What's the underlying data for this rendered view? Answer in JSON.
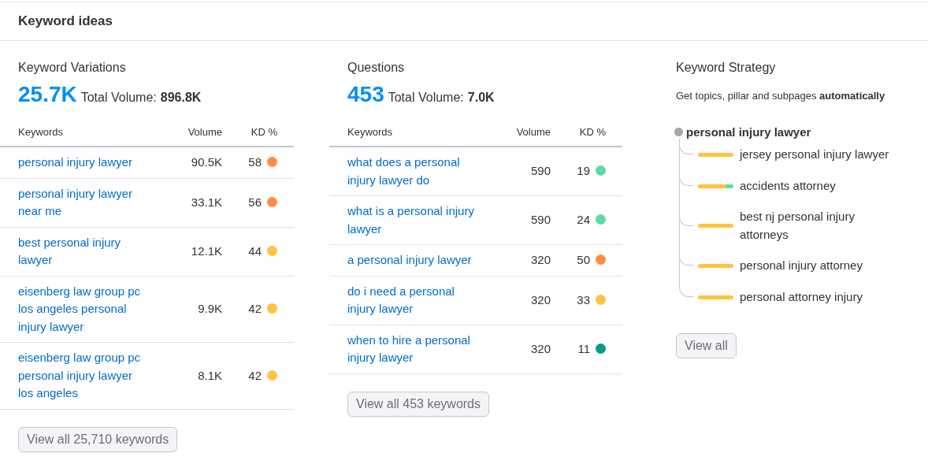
{
  "header": {
    "title": "Keyword ideas"
  },
  "variations": {
    "title": "Keyword Variations",
    "count": "25.7K",
    "total_label": "Total Volume:",
    "total_value": "896.8K",
    "columns": [
      "Keywords",
      "Volume",
      "KD %"
    ],
    "rows": [
      {
        "keyword": "personal injury lawyer",
        "volume": "90.5K",
        "kd": "58",
        "color": "#ff8c43"
      },
      {
        "keyword": "personal injury lawyer near me",
        "volume": "33.1K",
        "kd": "56",
        "color": "#ff8c43"
      },
      {
        "keyword": "best personal injury lawyer",
        "volume": "12.1K",
        "kd": "44",
        "color": "#ffc43d"
      },
      {
        "keyword": "eisenberg law group pc los angeles personal injury lawyer",
        "volume": "9.9K",
        "kd": "42",
        "color": "#ffc43d"
      },
      {
        "keyword": "eisenberg law group pc personal injury lawyer los angeles",
        "volume": "8.1K",
        "kd": "42",
        "color": "#ffc43d"
      }
    ],
    "button": "View all 25,710 keywords"
  },
  "questions": {
    "title": "Questions",
    "count": "453",
    "total_label": "Total Volume:",
    "total_value": "7.0K",
    "columns": [
      "Keywords",
      "Volume",
      "KD %"
    ],
    "rows": [
      {
        "keyword": "what does a personal injury lawyer do",
        "volume": "590",
        "kd": "19",
        "color": "#59dda5"
      },
      {
        "keyword": "what is a personal injury lawyer",
        "volume": "590",
        "kd": "24",
        "color": "#59dda5"
      },
      {
        "keyword": "a personal injury lawyer",
        "volume": "320",
        "kd": "50",
        "color": "#ff8c43"
      },
      {
        "keyword": "do i need a personal injury lawyer",
        "volume": "320",
        "kd": "33",
        "color": "#ffc43d"
      },
      {
        "keyword": "when to hire a personal injury lawyer",
        "volume": "320",
        "kd": "11",
        "color": "#009f81"
      }
    ],
    "button": "View all 453 keywords"
  },
  "strategy": {
    "title": "Keyword Strategy",
    "subtitle": "Get topics, pillar and subpages **automatically**",
    "root": {
      "label": "personal injury lawyer",
      "children": [
        {
          "label": "jersey personal injury lawyer",
          "segments": [
            {
              "color": "#ffc43d"
            }
          ]
        },
        {
          "label": "accidents attorney",
          "segments": [
            {
              "color": "#ffc43d"
            },
            {
              "color": "#59dda5"
            }
          ]
        },
        {
          "label": "best nj personal injury attorneys",
          "segments": [
            {
              "color": "#ffc43d"
            }
          ]
        },
        {
          "label": "personal injury attorney",
          "segments": [
            {
              "color": "#ffc43d"
            }
          ]
        },
        {
          "label": "personal attorney injury",
          "segments": [
            {
              "color": "#ffc43d"
            }
          ]
        }
      ]
    },
    "button": "View all"
  }
}
